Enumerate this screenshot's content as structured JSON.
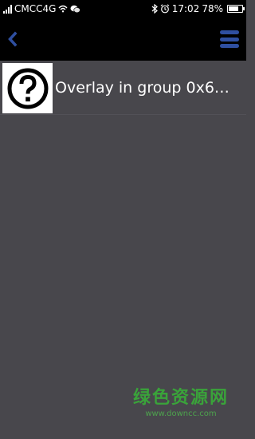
{
  "status_bar": {
    "carrier": "CMCC4G",
    "time": "17:02",
    "battery": "78%",
    "battery_level": 0.78,
    "icons": [
      "signal-icon",
      "wifi-icon",
      "wechat-icon",
      "bluetooth-icon",
      "alarm-icon",
      "battery-icon"
    ]
  },
  "app_bar": {
    "back_icon": "chevron-left-icon",
    "menu_icon": "hamburger-menu-icon",
    "accent_color": "#2f4fa0"
  },
  "list": {
    "items": [
      {
        "title": "Overlay in group 0x6…",
        "icon": "question-mark-icon"
      }
    ]
  },
  "watermark": {
    "title": "绿色资源网",
    "url": "www.downcc.com"
  }
}
